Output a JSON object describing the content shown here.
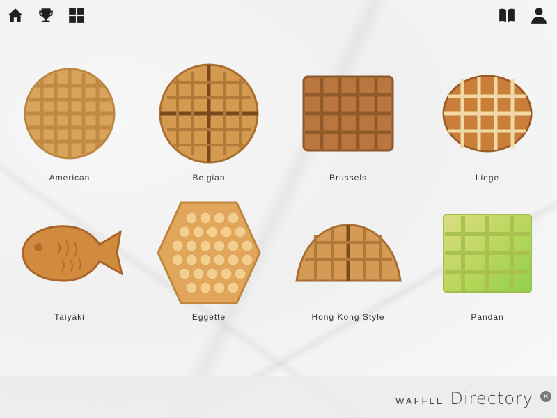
{
  "toolbar": {
    "left_icons": [
      "home-icon",
      "trophy-icon",
      "grid-icon"
    ],
    "right_icons": [
      "book-icon",
      "user-icon"
    ]
  },
  "waffles": [
    {
      "label": "American",
      "shape": "round-grid",
      "color": "#d8a35c"
    },
    {
      "label": "Belgian",
      "shape": "round-quartered",
      "color": "#d49a50"
    },
    {
      "label": "Brussels",
      "shape": "rect-grid",
      "color": "#b9773f"
    },
    {
      "label": "Liege",
      "shape": "oval-grid",
      "color": "#d4924a"
    },
    {
      "label": "Taiyaki",
      "shape": "fish",
      "color": "#d18a3e"
    },
    {
      "label": "Eggette",
      "shape": "bubble-hex",
      "color": "#e2b36d"
    },
    {
      "label": "Hong Kong Style",
      "shape": "half-circle",
      "color": "#d59a55"
    },
    {
      "label": "Pandan",
      "shape": "green-square",
      "color": "#b8d65a"
    }
  ],
  "footer": {
    "brand_small": "WAFFLE",
    "brand_big": "Directory",
    "close_glyph": "×"
  }
}
